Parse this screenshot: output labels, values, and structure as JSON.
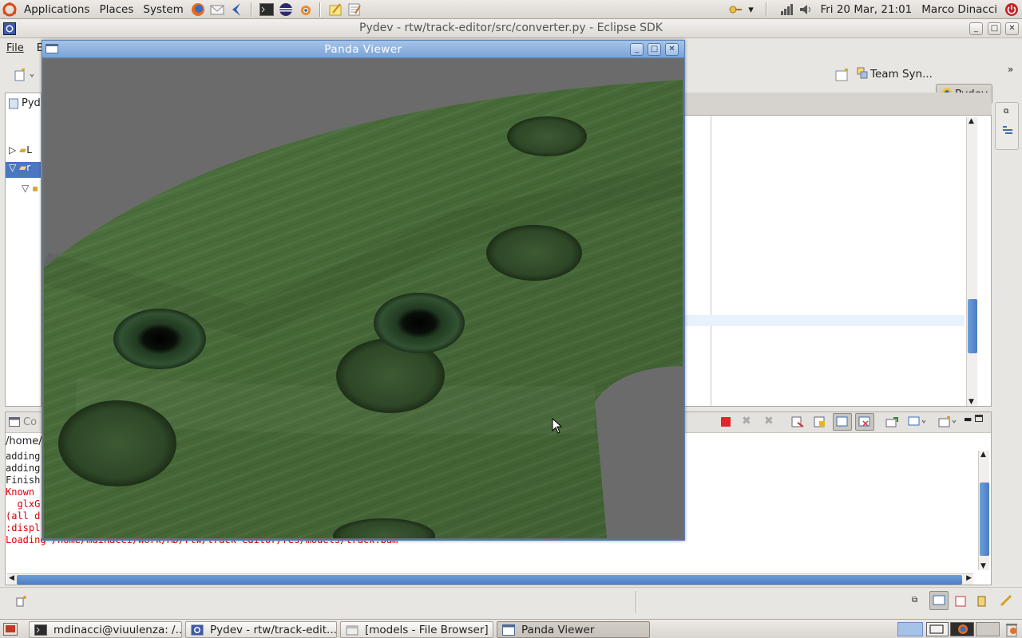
{
  "top_panel": {
    "menus": [
      "Applications",
      "Places",
      "System"
    ],
    "clock": "Fri 20 Mar, 21:01",
    "user": "Marco Dinacci"
  },
  "eclipse": {
    "window_title": "Pydev - rtw/track-editor/src/converter.py - Eclipse SDK",
    "menu": [
      "File",
      "E"
    ],
    "perspectives": [
      "Team Syn...",
      "Pydev"
    ],
    "left_view_title": "Pyd",
    "console_title": "Co",
    "console_path": "/home/",
    "console_lines": [
      {
        "text": "adding",
        "color": "black"
      },
      {
        "text": "adding",
        "color": "black"
      },
      {
        "text": "Finish",
        "color": "black"
      },
      {
        "text": "Known ",
        "color": "red"
      },
      {
        "text": "  glxG",
        "color": "red"
      },
      {
        "text": "(all d",
        "color": "red"
      },
      {
        "text": ":displ",
        "color": "red"
      },
      {
        "text": "Loading /home/mdinacci/Work/MD/rtw/track-editor/res/models/track.bam",
        "color": "red"
      }
    ],
    "tree_items": [
      "L",
      "r"
    ]
  },
  "panda": {
    "title": "Panda Viewer"
  },
  "taskbar": {
    "tasks": [
      {
        "label": "mdinacci@viuulenza: /..."
      },
      {
        "label": "Pydev - rtw/track-edit..."
      },
      {
        "label": "[models - File Browser]"
      },
      {
        "label": "Panda Viewer"
      }
    ]
  },
  "colors": {
    "panda_title": "#7aa3d6",
    "grass": "#4a6b3a",
    "background_grey": "#6b6b6b",
    "console_error": "#dd0000",
    "scroll_thumb": "#4a7dc4"
  }
}
